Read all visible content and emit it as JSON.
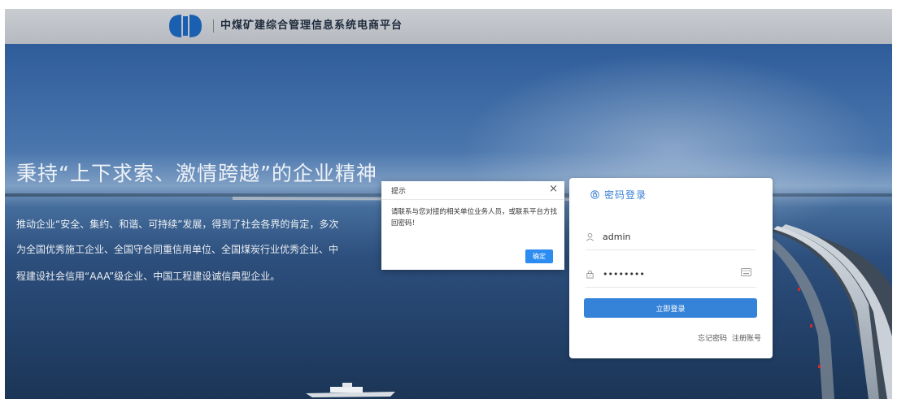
{
  "header": {
    "title": "中煤矿建综合管理信息系统电商平台",
    "logo_icon": "company-logo-icon"
  },
  "hero": {
    "slogan": "秉持“上下求索、激情跨越”的企业精神",
    "lines": [
      "推动企业“安全、集约、和谐、可持续”发展，得到了社会各界的肯定，多次",
      "为全国优秀施工企业、全国守合同重信用单位、全国煤炭行业优秀企业、中",
      "程建设社会信用“AAA”级企业、中国工程建设诚信典型企业。"
    ]
  },
  "login": {
    "tab_label": "密码登录",
    "tab_icon": "lock-circle-icon",
    "username_value": "admin",
    "username_icon": "user-icon",
    "password_value": "••••••••",
    "password_icon": "lock-icon",
    "keyboard_icon": "keyboard-icon",
    "submit_label": "立即登录",
    "forgot_label": "忘记密码",
    "register_label": "注册账号"
  },
  "dialog": {
    "title": "提示",
    "close_glyph": "×",
    "message": "请联系与您对接的相关单位业务人员，或联系平台方找回密码！",
    "ok_label": "确定"
  },
  "colors": {
    "accent": "#3583d8",
    "dialog_ok": "#2d8cf0",
    "header_bg": "#c2c6cc"
  }
}
